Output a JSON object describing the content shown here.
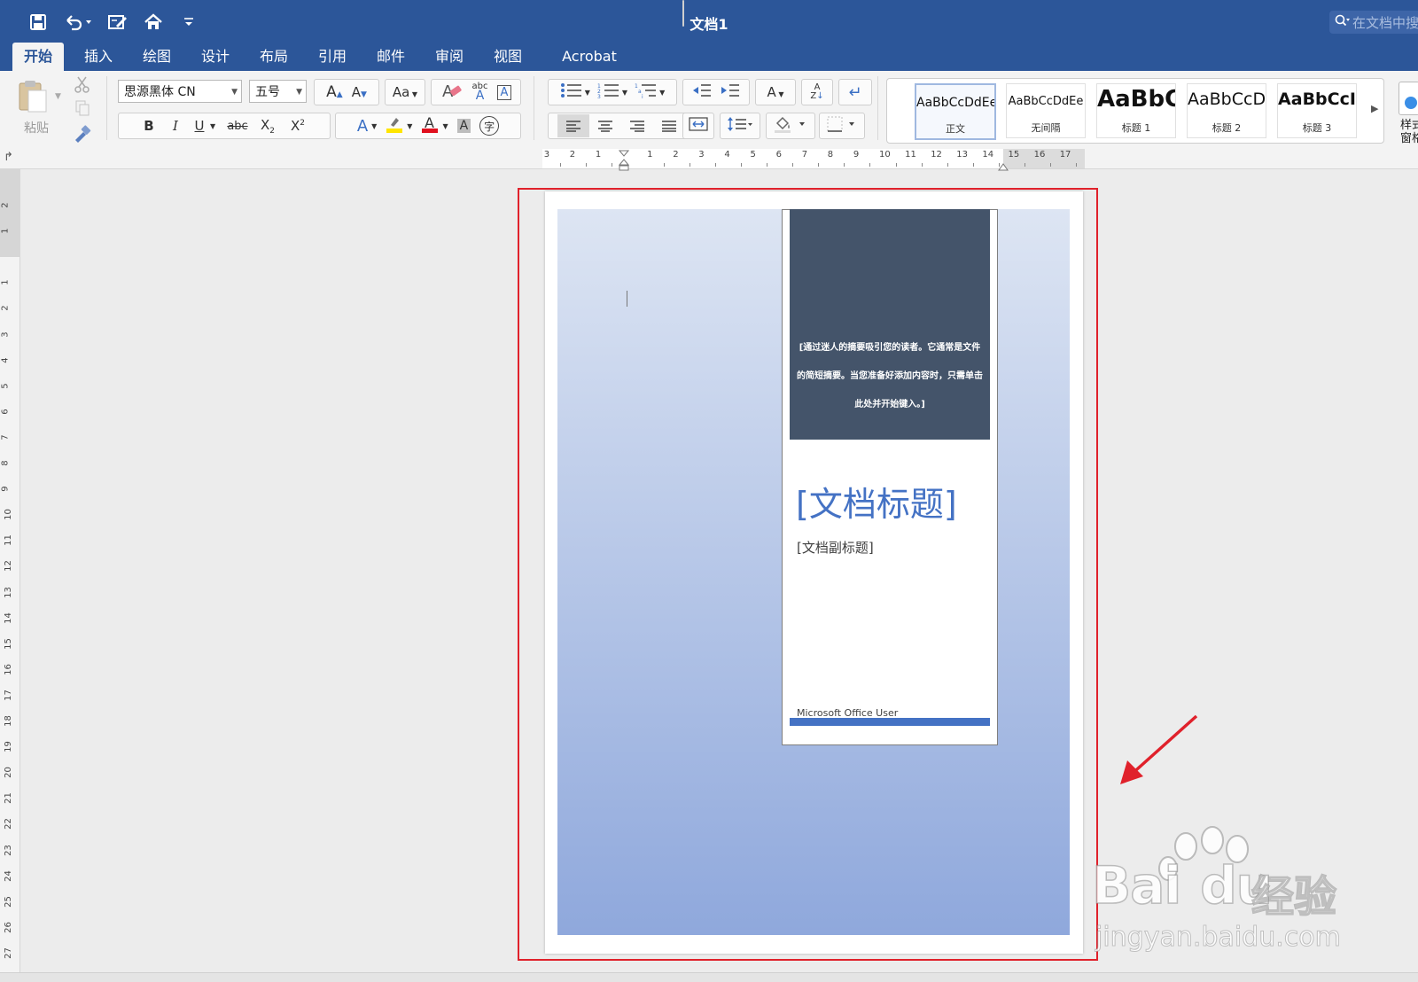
{
  "window": {
    "title": "文档1",
    "search_placeholder": "在文档中搜"
  },
  "quick_access": {
    "icons": [
      "save-icon",
      "undo-icon",
      "edit-doc-icon",
      "home-icon",
      "customize-icon"
    ]
  },
  "tabs": [
    {
      "label": "开始",
      "active": true
    },
    {
      "label": "插入"
    },
    {
      "label": "绘图"
    },
    {
      "label": "设计"
    },
    {
      "label": "布局"
    },
    {
      "label": "引用"
    },
    {
      "label": "邮件"
    },
    {
      "label": "审阅"
    },
    {
      "label": "视图"
    },
    {
      "label": "Acrobat"
    }
  ],
  "ribbon": {
    "paste_label": "粘贴",
    "font_name": "思源黑体 CN",
    "font_size": "五号",
    "bold": "B",
    "italic": "I",
    "underline": "U",
    "strike": "abc",
    "subscript": "X",
    "superscript": "X",
    "char_border": "字",
    "sort": "A",
    "styles_pane_label": "样式\n窗格",
    "styles": [
      {
        "sample": "AaBbCcDdEe",
        "label": "正文",
        "selected": true
      },
      {
        "sample": "AaBbCcDdEe",
        "label": "无间隔"
      },
      {
        "sample": "AaBbC",
        "label": "标题 1"
      },
      {
        "sample": "AaBbCcD",
        "label": "标题 2"
      },
      {
        "sample": "AaBbCcI",
        "label": "标题 3"
      }
    ]
  },
  "ruler": {
    "horizontal": [
      "3",
      "2",
      "1",
      "1",
      "2",
      "3",
      "4",
      "5",
      "6",
      "7",
      "8",
      "9",
      "10",
      "11",
      "12",
      "13",
      "14",
      "15",
      "16",
      "17"
    ],
    "vertical": [
      "2",
      "1",
      "1",
      "2",
      "3",
      "4",
      "5",
      "6",
      "7",
      "8",
      "9",
      "10",
      "11",
      "12",
      "13",
      "14",
      "15",
      "16",
      "17",
      "18",
      "19",
      "20",
      "21",
      "22",
      "23",
      "24",
      "25",
      "26",
      "27"
    ]
  },
  "document": {
    "abstract": "[通过迷人的摘要吸引您的读者。它通常是文件的简短摘要。当您准备好添加内容时，只需单击此处并开始键入。]",
    "title": "[文档标题]",
    "subtitle": "[文档副标题]",
    "author": "Microsoft Office User"
  },
  "watermark": {
    "brand": "Bai",
    "brand2": "du",
    "product": "经验",
    "url": "jingyan.baidu.com"
  },
  "colors": {
    "titlebar": "#2c5699",
    "accent": "#4472c4",
    "abstract_bg": "#44546a",
    "highlight": "#e0212b"
  }
}
